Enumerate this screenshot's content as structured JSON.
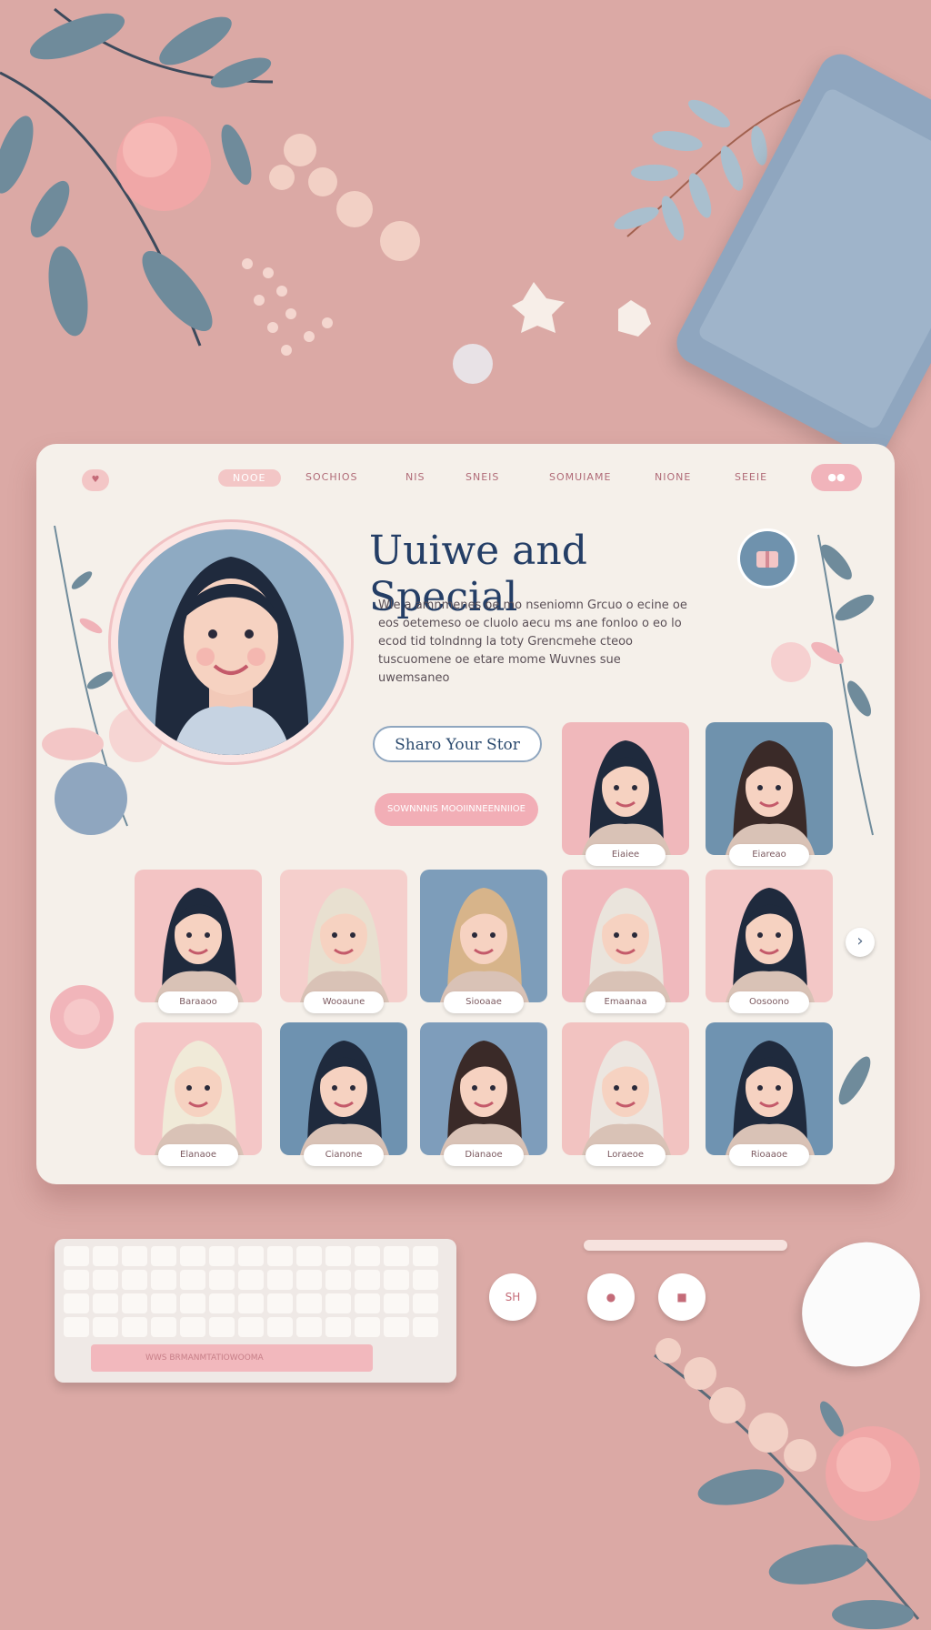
{
  "colors": {
    "desk": "#dba9a5",
    "screen": "#f5f0ea",
    "accent_pink": "#f2aeb6",
    "accent_blue": "#8fa6bf",
    "title_navy": "#243e66"
  },
  "nav": {
    "logo_icon": "heart-logo-icon",
    "items": [
      "NOOE",
      "SOCHIOS",
      "NIS",
      "SNEIS",
      "SOMUIAME",
      "NIONE",
      "SEEIE"
    ],
    "active_index": 0,
    "action_label": "●●"
  },
  "hero": {
    "title": "Uuiwe and Special",
    "description": "Wle a amnmenes oe mo nseniomn Grcuo o ecine oe eos oetemeso oe cluolo aecu ms ane fonloo o eo lo ecod tid tolndnng la toty Grencmehe cteoo tuscuomene oe etare mome Wuvnes sue uwemsaneo",
    "share_button": "Sharo Your Stor",
    "secondary_button": "SOWNNNIS MOOIINNEENNIIOE"
  },
  "gallery": {
    "cards": [
      {
        "name": "Eiaiee",
        "bg": "#f0b8bb"
      },
      {
        "name": "Eiareao",
        "bg": "#6f92ad"
      },
      {
        "name": "Baraaoo",
        "bg": "#f3c4c4"
      },
      {
        "name": "Wooaune",
        "bg": "#f5cfcc"
      },
      {
        "name": "Siooaae",
        "bg": "#7d9dba"
      },
      {
        "name": "Emaanaa",
        "bg": "#f0b9bd"
      },
      {
        "name": "Oosoono",
        "bg": "#f3c7c6"
      },
      {
        "name": "Elanaoe",
        "bg": "#f4c6c6"
      },
      {
        "name": "Cianone",
        "bg": "#6e92b0"
      },
      {
        "name": "Dianaoe",
        "bg": "#7e9dbb"
      },
      {
        "name": "Loraeoe",
        "bg": "#f2c3c1"
      },
      {
        "name": "Rioaaoe",
        "bg": "#6f93b1"
      }
    ],
    "next_icon": "chevron-right-icon",
    "next_glyph": "›"
  },
  "desk": {
    "keyboard_bar_text": "WWS BRMANMTATIOWOOMA",
    "circle_buttons": [
      {
        "icon": "profile-icon",
        "label": "SH"
      },
      {
        "icon": "chat-icon",
        "label": ""
      },
      {
        "icon": "camera-icon",
        "label": ""
      }
    ]
  }
}
